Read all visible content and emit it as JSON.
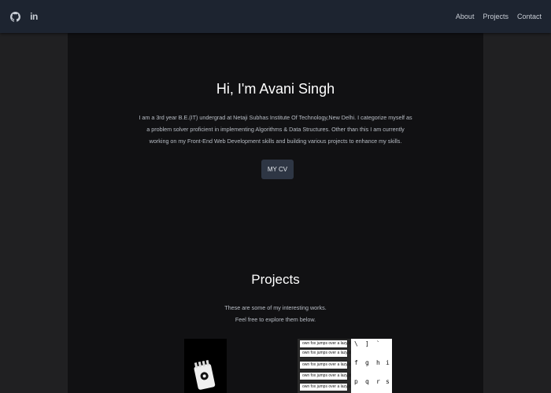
{
  "nav": {
    "social": [
      "github-icon",
      "linkedin-icon"
    ],
    "linkedin_text": "in",
    "links": [
      "About",
      "Projects",
      "Contact"
    ]
  },
  "hero": {
    "title": "Hi, I'm Avani Singh",
    "description": "I am a 3rd year B.E.(IT) undergrad at Netaji Subhas Institute Of Technology,New Delhi. I categorize myself as a problem solver proficient in implementing Algorithms & Data Structures. Other than this I am currently working on my Front-End Web Development skills and building various projects to enhance my skills.",
    "cv_label": "MY CV"
  },
  "projects": {
    "title": "Projects",
    "line1": "These are some of my interesting works.",
    "line2": "Feel free to explore them below.",
    "typing_text": "own fox jumps over a lazy dog.",
    "keys": [
      "\\",
      "]",
      "`",
      "f",
      "g",
      "h",
      "i",
      "p",
      "q",
      "r",
      "s"
    ]
  },
  "colors": {
    "navbar": "#1d2430",
    "background": "#111113",
    "side": "#202022",
    "button": "#2e3644"
  }
}
